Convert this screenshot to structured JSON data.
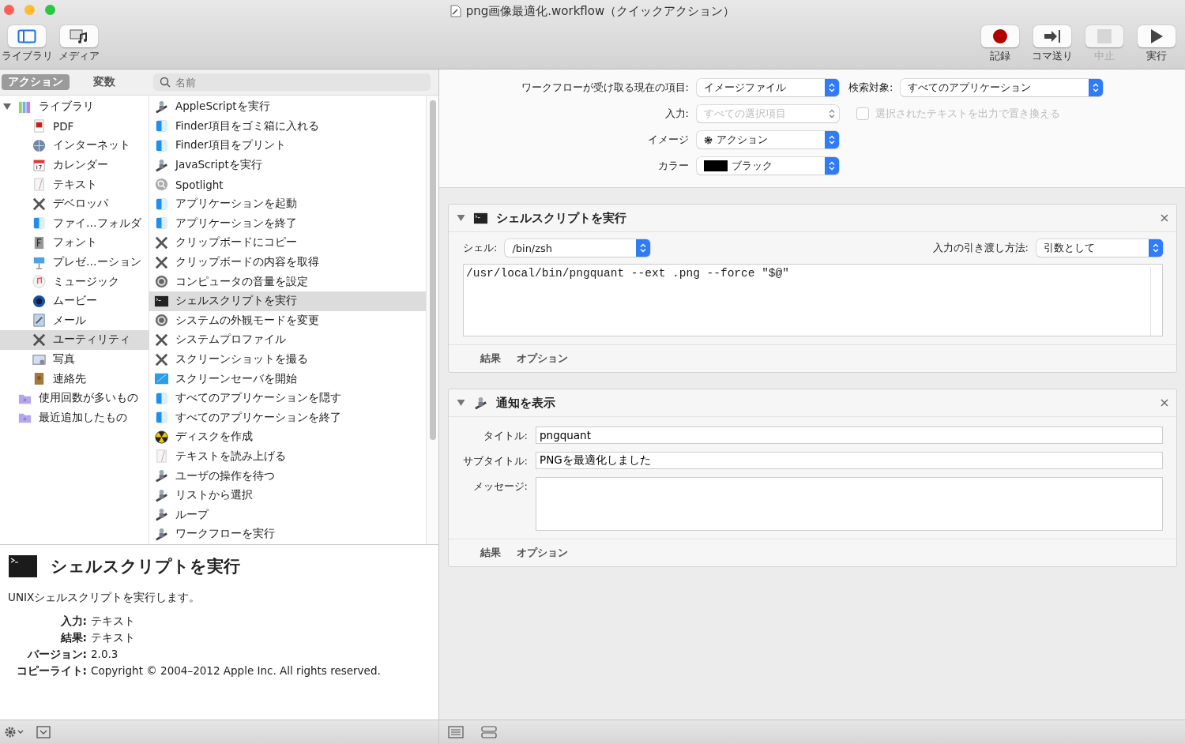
{
  "window": {
    "title": "png画像最適化.workflow（クイックアクション）"
  },
  "toolbar_left": [
    {
      "label": "ライブラリ",
      "kind": "library",
      "disabled": false
    },
    {
      "label": "メディア",
      "kind": "media",
      "disabled": false
    }
  ],
  "toolbar_right": [
    {
      "label": "記録",
      "kind": "record",
      "disabled": false
    },
    {
      "label": "コマ送り",
      "kind": "step",
      "disabled": false
    },
    {
      "label": "中止",
      "kind": "stop",
      "disabled": true
    },
    {
      "label": "実行",
      "kind": "run",
      "disabled": false
    }
  ],
  "tabs": [
    {
      "label": "アクション",
      "selected": true
    },
    {
      "label": "変数",
      "selected": false
    }
  ],
  "search": {
    "placeholder": "名前"
  },
  "sidebar": {
    "items": [
      {
        "label": "ライブラリ",
        "kind": "library",
        "expanded": true,
        "selected": false,
        "children": [
          {
            "label": "PDF",
            "kind": "pdf",
            "selected": false
          },
          {
            "label": "インターネット",
            "kind": "globe",
            "selected": false
          },
          {
            "label": "カレンダー",
            "kind": "calendar",
            "selected": false
          },
          {
            "label": "テキスト",
            "kind": "note",
            "selected": false
          },
          {
            "label": "デベロッパ",
            "kind": "tools",
            "selected": false
          },
          {
            "label": "ファイ…フォルダ",
            "kind": "finder",
            "selected": false
          },
          {
            "label": "フォント",
            "kind": "font",
            "selected": false
          },
          {
            "label": "プレゼ…ーション",
            "kind": "presentation",
            "selected": false
          },
          {
            "label": "ミュージック",
            "kind": "music",
            "selected": false
          },
          {
            "label": "ムービー",
            "kind": "movie",
            "selected": false
          },
          {
            "label": "メール",
            "kind": "mail",
            "selected": false
          },
          {
            "label": "ユーティリティ",
            "kind": "tools",
            "selected": true
          },
          {
            "label": "写真",
            "kind": "photo",
            "selected": false
          },
          {
            "label": "連絡先",
            "kind": "contacts",
            "selected": false
          }
        ]
      },
      {
        "label": "使用回数が多いもの",
        "kind": "folder",
        "selected": false
      },
      {
        "label": "最近追加したもの",
        "kind": "folder",
        "selected": false
      }
    ]
  },
  "actions": [
    {
      "label": "AppleScriptを実行",
      "kind": "robot",
      "selected": false
    },
    {
      "label": "Finder項目をゴミ箱に入れる",
      "kind": "finder",
      "selected": false
    },
    {
      "label": "Finder項目をプリント",
      "kind": "finder",
      "selected": false
    },
    {
      "label": "JavaScriptを実行",
      "kind": "robot",
      "selected": false
    },
    {
      "label": "Spotlight",
      "kind": "spotlight",
      "selected": false
    },
    {
      "label": "アプリケーションを起動",
      "kind": "finder",
      "selected": false
    },
    {
      "label": "アプリケーションを終了",
      "kind": "finder",
      "selected": false
    },
    {
      "label": "クリップボードにコピー",
      "kind": "tools",
      "selected": false
    },
    {
      "label": "クリップボードの内容を取得",
      "kind": "tools",
      "selected": false
    },
    {
      "label": "コンピュータの音量を設定",
      "kind": "gear",
      "selected": false
    },
    {
      "label": "シェルスクリプトを実行",
      "kind": "terminal",
      "selected": true
    },
    {
      "label": "システムの外観モードを変更",
      "kind": "gear",
      "selected": false
    },
    {
      "label": "システムプロファイル",
      "kind": "tools",
      "selected": false
    },
    {
      "label": "スクリーンショットを撮る",
      "kind": "tools",
      "selected": false
    },
    {
      "label": "スクリーンセーバを開始",
      "kind": "screensaver",
      "selected": false
    },
    {
      "label": "すべてのアプリケーションを隠す",
      "kind": "finder",
      "selected": false
    },
    {
      "label": "すべてのアプリケーションを終了",
      "kind": "finder",
      "selected": false
    },
    {
      "label": "ディスクを作成",
      "kind": "disk",
      "selected": false
    },
    {
      "label": "テキストを読み上げる",
      "kind": "note",
      "selected": false
    },
    {
      "label": "ユーザの操作を待つ",
      "kind": "robot",
      "selected": false
    },
    {
      "label": "リストから選択",
      "kind": "robot",
      "selected": false
    },
    {
      "label": "ループ",
      "kind": "robot",
      "selected": false
    },
    {
      "label": "ワークフローを実行",
      "kind": "robot",
      "selected": false
    }
  ],
  "description": {
    "title": "シェルスクリプトを実行",
    "text": "UNIXシェルスクリプトを実行します。",
    "details": [
      {
        "label": "入力:",
        "value": "テキスト"
      },
      {
        "label": "結果:",
        "value": "テキスト"
      },
      {
        "label": "バージョン:",
        "value": "2.0.3"
      },
      {
        "label": "コピーライト:",
        "value": "Copyright © 2004–2012 Apple Inc.  All rights reserved."
      }
    ]
  },
  "workflow_settings": {
    "receives": {
      "label": "ワークフローが受け取る現在の項目:",
      "value": "イメージファイル"
    },
    "search_in": {
      "label": "検索対象:",
      "value": "すべてのアプリケーション"
    },
    "input": {
      "label": "入力:",
      "value": "すべての選択項目",
      "disabled": true
    },
    "replace_text": {
      "label": "選択されたテキストを出力で置き換える",
      "checked": false,
      "disabled": true
    },
    "image": {
      "label": "イメージ",
      "value": "アクション"
    },
    "color": {
      "label": "カラー",
      "value": "ブラック",
      "color": "#000000"
    }
  },
  "workflow_actions": [
    {
      "kind": "shell",
      "title": "シェルスクリプトを実行",
      "expanded": true,
      "shell": {
        "label": "シェル:",
        "value": "/bin/zsh"
      },
      "pass_input": {
        "label": "入力の引き渡し方法:",
        "value": "引数として"
      },
      "script": "/usr/local/bin/pngquant --ext .png --force \"$@\"",
      "footer": [
        "結果",
        "オプション"
      ]
    },
    {
      "kind": "notification",
      "title": "通知を表示",
      "expanded": true,
      "fields": [
        {
          "label": "タイトル:",
          "value": "pngquant",
          "kind": "text"
        },
        {
          "label": "サブタイトル:",
          "value": "PNGを最適化しました",
          "kind": "text"
        },
        {
          "label": "メッセージ:",
          "kind": "textarea"
        }
      ],
      "footer": [
        "結果",
        "オプション"
      ]
    }
  ]
}
